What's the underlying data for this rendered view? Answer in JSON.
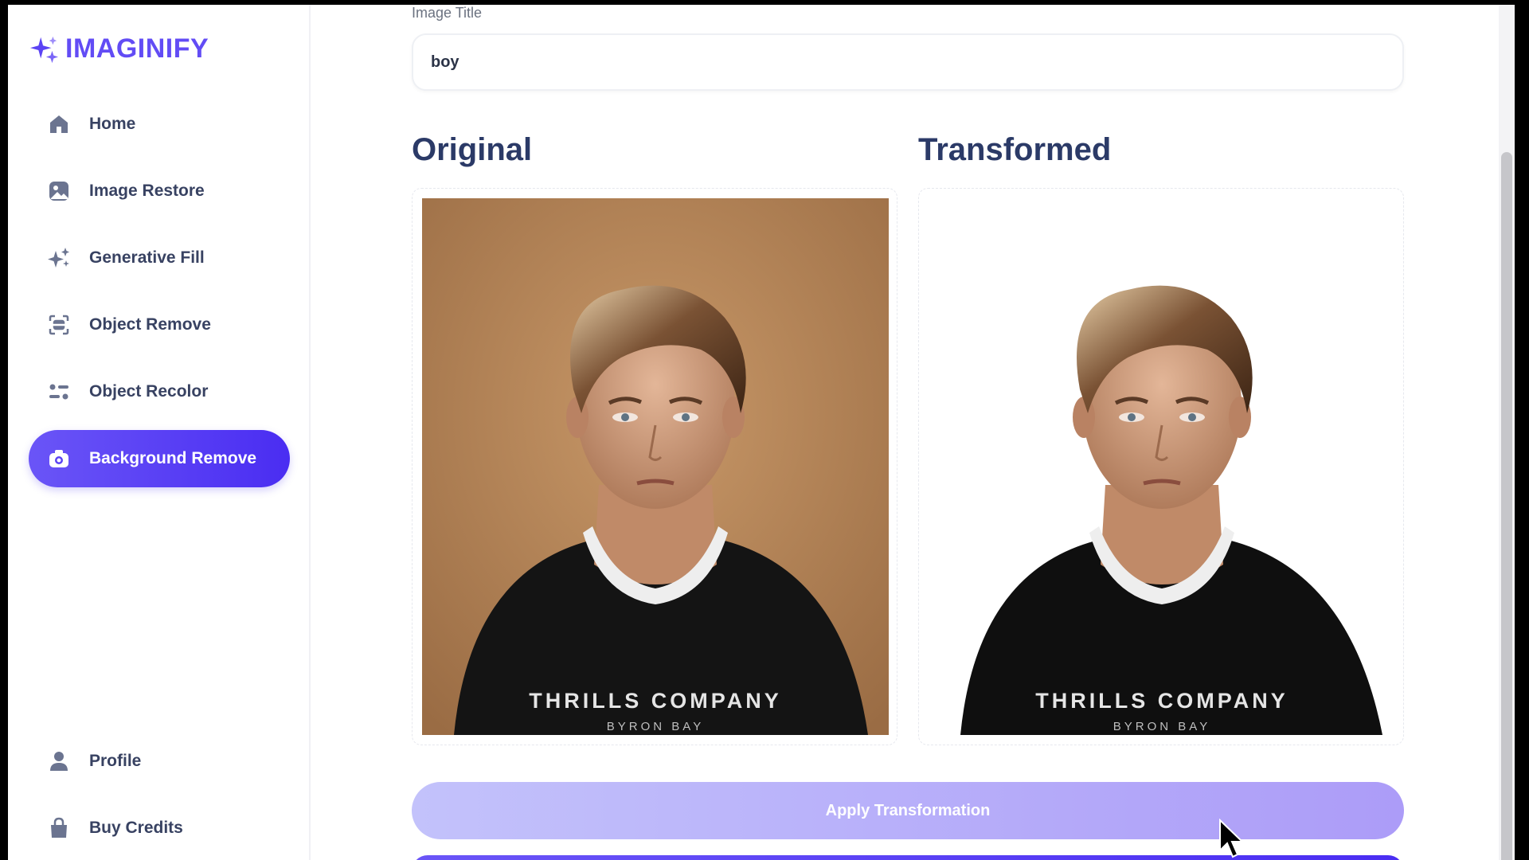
{
  "brand": {
    "name": "IMAGINIFY",
    "icon": "sparkle-logo-icon",
    "color": "#624cf5"
  },
  "sidebar": {
    "items": [
      {
        "label": "Home",
        "icon": "home-icon"
      },
      {
        "label": "Image Restore",
        "icon": "image-icon"
      },
      {
        "label": "Generative Fill",
        "icon": "sparkles-icon"
      },
      {
        "label": "Object Remove",
        "icon": "scan-icon"
      },
      {
        "label": "Object Recolor",
        "icon": "filter-icon"
      },
      {
        "label": "Background Remove",
        "icon": "camera-icon",
        "active": true
      }
    ],
    "bottom_items": [
      {
        "label": "Profile",
        "icon": "user-icon"
      },
      {
        "label": "Buy Credits",
        "icon": "bag-icon"
      }
    ]
  },
  "form": {
    "title_label": "Image Title",
    "title_value": "boy"
  },
  "panels": {
    "original_heading": "Original",
    "transformed_heading": "Transformed",
    "shirt_text": "THRILLS COMPANY",
    "shirt_subtext": "BYRON BAY"
  },
  "actions": {
    "apply_label": "Apply Transformation"
  },
  "colors": {
    "accent": "#5b43f4",
    "heading": "#2b3a67",
    "apply_button_start": "#c3c2fb",
    "apply_button_end": "#ac9cf8"
  }
}
